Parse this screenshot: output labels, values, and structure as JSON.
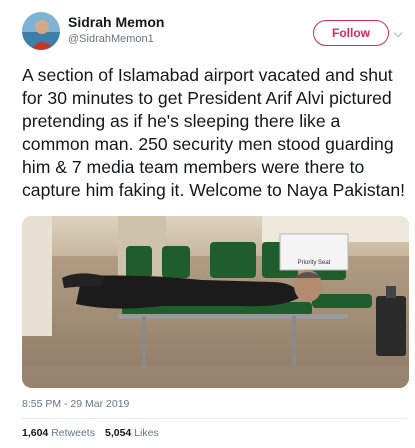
{
  "tweet": {
    "author_name": "Sidrah Memon",
    "author_handle": "@SidrahMemon1",
    "follow_label": "Follow",
    "caret_icon": "chevron-down-icon",
    "text": "A section of Islamabad airport vacated and shut for 30 minutes to get President Arif Alvi pictured pretending as if he's sleeping there like a common man. 250 security men stood guarding him & 7 media team members were there to capture him faking it. Welcome to Naya Pakistan!",
    "timestamp": "8:55 PM - 29 Mar 2019",
    "retweets_count": "1,604",
    "retweets_label": "Retweets",
    "likes_count": "5,054",
    "likes_label": "Likes",
    "sign_text": "Priority Seat"
  },
  "colors": {
    "follow_accent": "#e0245e",
    "secondary_text": "#657786",
    "primary_text": "#14171a"
  }
}
